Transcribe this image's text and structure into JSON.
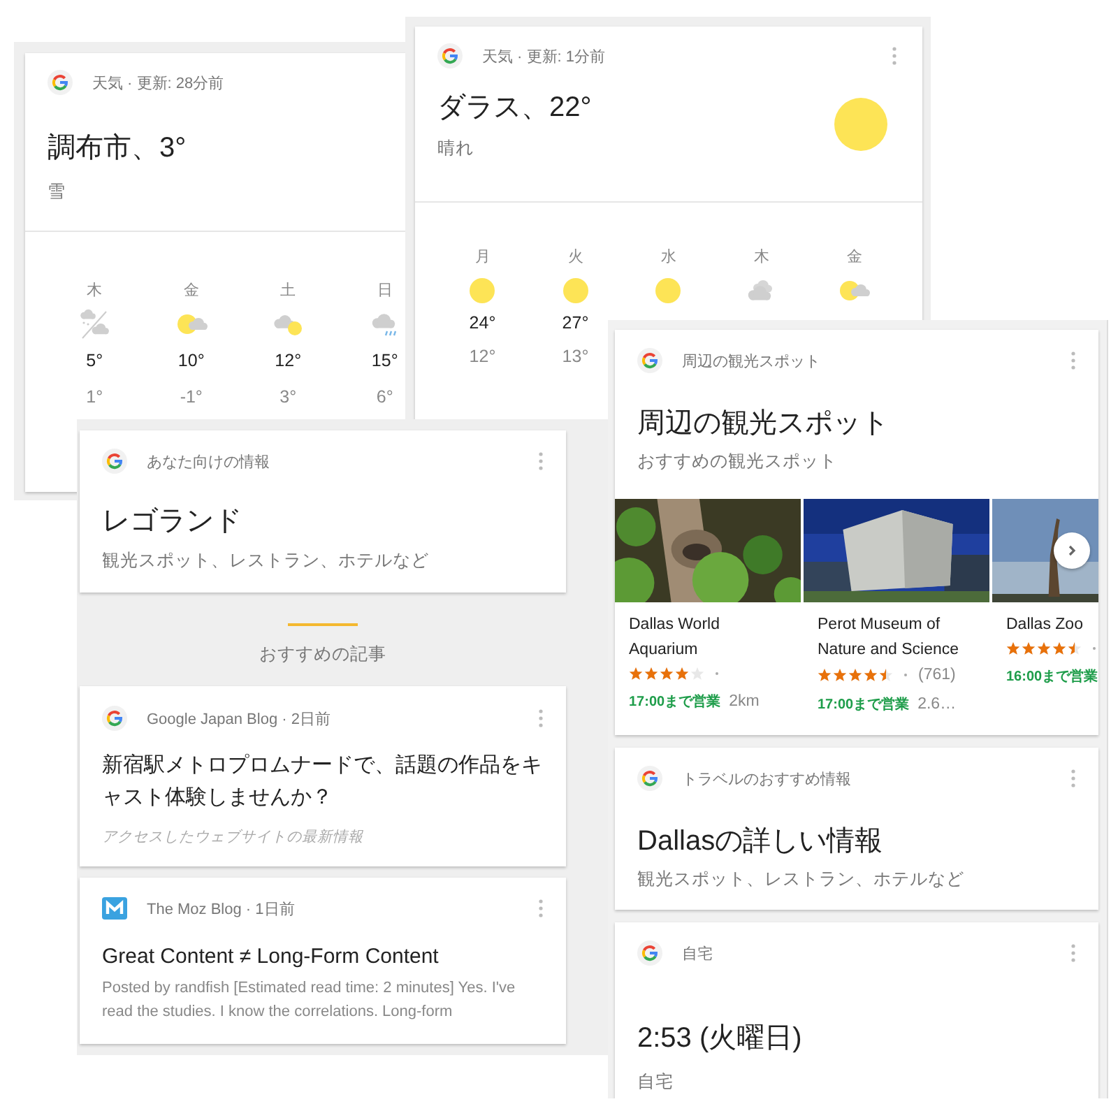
{
  "chofu_weather": {
    "header": "天気 · 更新: 28分前",
    "title": "調布市、3°",
    "condition": "雪",
    "forecast": [
      {
        "day": "木",
        "kind": "snow",
        "high": "5°",
        "low": "1°"
      },
      {
        "day": "金",
        "kind": "sun_cloud",
        "high": "10°",
        "low": "-1°"
      },
      {
        "day": "土",
        "kind": "cloud_sun",
        "high": "12°",
        "low": "3°"
      },
      {
        "day": "日",
        "kind": "cloud_rain",
        "high": "15°",
        "low": "6°"
      }
    ]
  },
  "dallas_weather": {
    "header": "天気 · 更新: 1分前",
    "title": "ダラス、22°",
    "condition": "晴れ",
    "kind": "sunny",
    "forecast": [
      {
        "day": "月",
        "kind": "sunny",
        "high": "24°",
        "low": "12°"
      },
      {
        "day": "火",
        "kind": "sunny",
        "high": "27°",
        "low": "13°"
      },
      {
        "day": "水",
        "kind": "sunny"
      },
      {
        "day": "木",
        "kind": "cloudy"
      },
      {
        "day": "金",
        "kind": "sun_cloud"
      }
    ]
  },
  "feed_left": {
    "top_card": {
      "header": "あなた向けの情報",
      "title": "レゴランド",
      "subtitle": "観光スポット、レストラン、ホテルなど"
    },
    "section_title": "おすすめの記事",
    "articles": [
      {
        "kind": "google",
        "source": "Google Japan Blog · 2日前",
        "title": "新宿駅メトロプロムナードで、話題の作品をキャスト体験しませんか？",
        "note": "アクセスしたウェブサイトの最新情報"
      },
      {
        "kind": "moz",
        "source": "The Moz Blog · 1日前",
        "title": "Great Content ≠ Long-Form Content",
        "excerpt": "Posted by randfish [Estimated read time: 2 minutes] Yes. I've read the studies. I know the correlations. Long-form"
      }
    ]
  },
  "feed_right": {
    "nearby": {
      "header": "周辺の観光スポット",
      "title": "周辺の観光スポット",
      "subtitle": "おすすめの観光スポット",
      "places": [
        {
          "kind": "aquarium",
          "name": "Dallas World Aquarium",
          "stars": 4,
          "hours": "17:00まで営業",
          "distance": "2km"
        },
        {
          "kind": "museum",
          "name": "Perot Museum of Nature and Science",
          "stars": 4.5,
          "reviews": "(761)",
          "hours": "17:00まで営業",
          "distance": "2.6…"
        },
        {
          "kind": "zoo",
          "name": "Dallas Zoo",
          "stars": 4.5,
          "hours": "16:00まで営業"
        }
      ]
    },
    "cards": [
      {
        "header": "トラベルのおすすめ情報",
        "title": "Dallasの詳しい情報",
        "subtitle": "観光スポット、レストラン、ホテルなど"
      },
      {
        "header": "自宅",
        "title": "2:53 (火曜日)",
        "subtitle": "自宅"
      }
    ]
  }
}
